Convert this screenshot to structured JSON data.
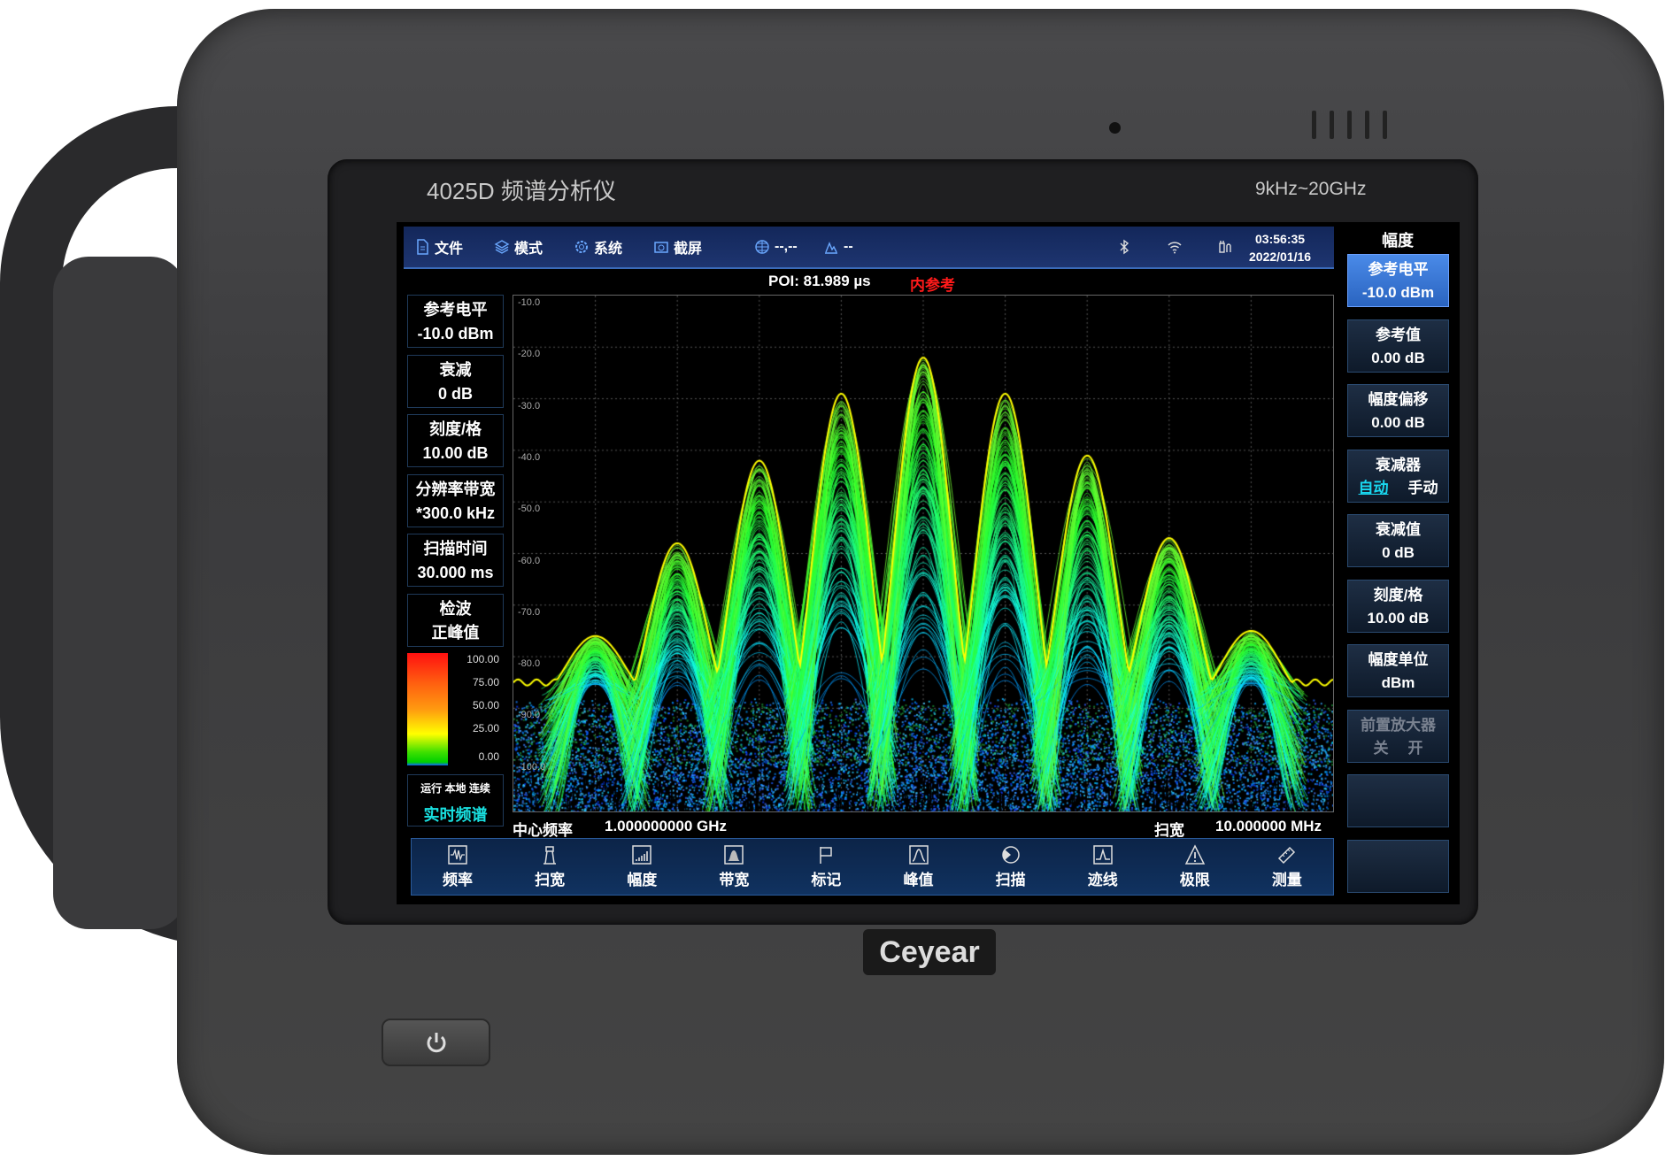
{
  "device": {
    "title": "4025D 频谱分析仪",
    "range": "9kHz~20GHz",
    "logo": "Ceyear"
  },
  "toolbar": {
    "file": "文件",
    "mode": "模式",
    "system": "系统",
    "screenshot": "截屏",
    "gps": "--,--",
    "trace_status": "--",
    "time": "03:56:35",
    "date": "2022/01/16"
  },
  "status_line": {
    "poi": "POI: 81.989 µs",
    "reference": "内参考"
  },
  "left_panel": [
    {
      "label": "参考电平",
      "value": "-10.0 dBm"
    },
    {
      "label": "衰减",
      "value": "0 dB"
    },
    {
      "label": "刻度/格",
      "value": "10.00 dB"
    },
    {
      "label": "分辨率带宽",
      "value": "*300.0 kHz"
    },
    {
      "label": "扫描时间",
      "value": "30.000 ms"
    },
    {
      "label": "检波",
      "value": "正峰值"
    }
  ],
  "colorbar": {
    "labels": [
      "100.00",
      "75.00",
      "50.00",
      "25.00",
      "0.00"
    ]
  },
  "run_status": {
    "line": "运行 本地 连续",
    "mode": "实时频谱",
    "mode_color": "#19e0e0"
  },
  "plot": {
    "y_ticks": [
      "-10.0",
      "-20.0",
      "-30.0",
      "-40.0",
      "-50.0",
      "-60.0",
      "-70.0",
      "-80.0",
      "-90.0",
      "-100.0"
    ],
    "ylim_dbm": [
      -110,
      -10
    ],
    "x_divisions": 10,
    "grid": true,
    "trace": {
      "lobe_offsets_mhz": [
        -4,
        -3,
        -2,
        -1,
        0,
        1,
        2,
        3,
        4
      ],
      "lobe_peaks_dbm": [
        -76,
        -58,
        -42,
        -29,
        -22,
        -29,
        -41,
        -57,
        -75
      ],
      "noise_floor_dbm": -86
    },
    "trace_color": "#ffff00"
  },
  "footer": {
    "center_label": "中心频率",
    "center_value": "1.000000000 GHz",
    "span_label": "扫宽",
    "span_value": "10.000000 MHz"
  },
  "bottom_menu": [
    {
      "label": "频率",
      "icon": "frequency-icon"
    },
    {
      "label": "扫宽",
      "icon": "span-icon"
    },
    {
      "label": "幅度",
      "icon": "amplitude-icon"
    },
    {
      "label": "带宽",
      "icon": "bandwidth-icon"
    },
    {
      "label": "标记",
      "icon": "marker-flag-icon"
    },
    {
      "label": "峰值",
      "icon": "peak-icon"
    },
    {
      "label": "扫描",
      "icon": "sweep-icon"
    },
    {
      "label": "迹线",
      "icon": "trace-icon"
    },
    {
      "label": "极限",
      "icon": "limit-warning-icon"
    },
    {
      "label": "测量",
      "icon": "measure-ruler-icon"
    }
  ],
  "right_panel": {
    "title": "幅度",
    "buttons": [
      {
        "label": "参考电平",
        "value": "-10.0 dBm",
        "active": true
      },
      {
        "label": "参考值",
        "value": "0.00 dB"
      },
      {
        "label": "幅度偏移",
        "value": "0.00 dB"
      },
      {
        "label": "衰减器",
        "opt1": "自动",
        "opt2": "手动",
        "selected": "自动"
      },
      {
        "label": "衰减值",
        "value": "0 dB"
      },
      {
        "label": "刻度/格",
        "value": "10.00 dB"
      },
      {
        "label": "幅度单位",
        "value": "dBm"
      },
      {
        "label": "前置放大器",
        "opt1": "关",
        "opt2": "开",
        "disabled": true
      },
      {
        "label": "",
        "value": ""
      },
      {
        "label": "",
        "value": ""
      }
    ]
  }
}
